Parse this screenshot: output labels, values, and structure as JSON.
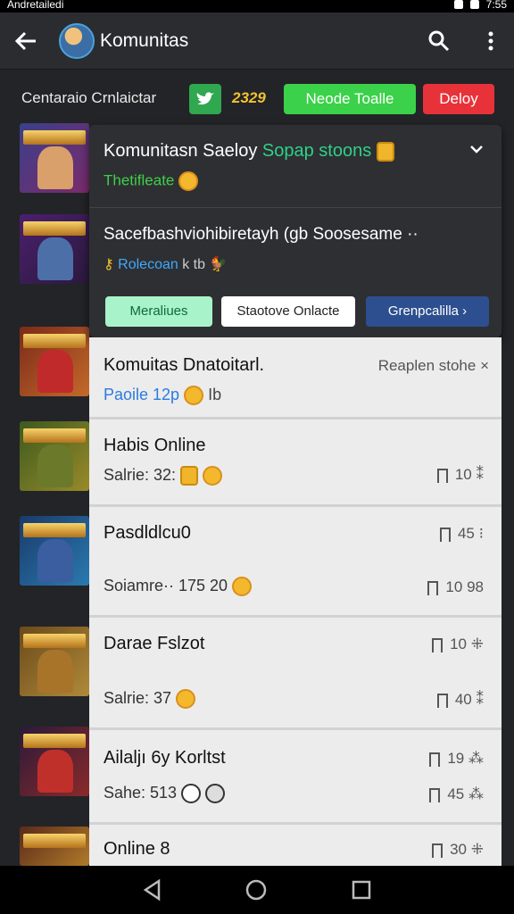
{
  "status_bar": {
    "carrier": "Andretailedi",
    "time": "7:55"
  },
  "header": {
    "title": "Komunitas"
  },
  "filter": {
    "label": "Centaraio Crnlaictar",
    "count": "2329",
    "green_button": "Neode Toalle",
    "red_button": "Deloy"
  },
  "popup": {
    "title_main": "Komunitasn Saeloy",
    "title_highlight": "Sopap stoons",
    "subtitle": "Thetifleate",
    "line2": "Sacefbashviohibiretayh (gb Soosesame",
    "meta_link": "Rolecoan",
    "meta_key": "k tb",
    "chip1": "Meraliues",
    "chip2": "Staotove Onlacte",
    "chip3": "Grenpcalilla ›"
  },
  "list": {
    "rows": [
      {
        "title": "Komuitas Dnatoitarl.",
        "sub": "Paoile 12p",
        "sub_tail": "Ib",
        "metric_note": "Reaplen stohe ×"
      },
      {
        "title": "Habis Online",
        "sub": "Salrie: 32:",
        "metric": "10",
        "metric_tail": "⁑"
      },
      {
        "title": "Pasdldlcu0",
        "sub": "Soiamre·· 175 20",
        "metric": "45",
        "metric_tail": "⁝",
        "metric2": "10",
        "metric2_tail": "98"
      },
      {
        "title": "Darae Fslzot",
        "sub": "Salrie: 37",
        "metric": "10",
        "metric_tail": "⁜",
        "metric2": "40",
        "metric2_tail": "⁑"
      },
      {
        "title": "Ailaljı 6y Korltst",
        "sub": "Sahe: 513",
        "metric": "19",
        "metric_tail": "⁂",
        "metric2": "45",
        "metric2_tail": "⁂"
      },
      {
        "title": "Online 8",
        "metric": "30",
        "metric_tail": "⁜"
      }
    ]
  },
  "colors": {
    "accent_green": "#3bd14a",
    "accent_red": "#e8323a",
    "link_blue": "#2b7be0"
  }
}
